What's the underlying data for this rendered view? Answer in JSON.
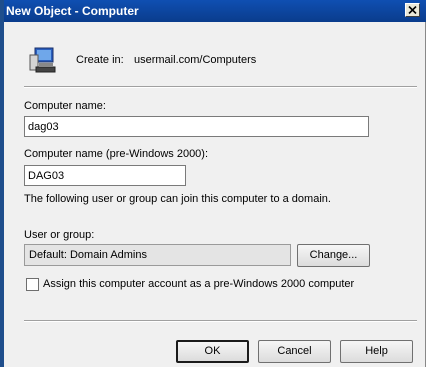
{
  "window": {
    "title": "New Object - Computer",
    "close_icon": "close-icon"
  },
  "header": {
    "icon": "computer-icon",
    "create_in_label": "Create in:",
    "create_in_value": "usermail.com/Computers"
  },
  "form": {
    "computer_name_label": "Computer name:",
    "computer_name_value": "dag03",
    "pre2000_label": "Computer name (pre-Windows 2000):",
    "pre2000_value": "DAG03",
    "info_text": "The following user or group can join this computer to a domain.",
    "user_group_label": "User or group:",
    "user_group_value": "Default: Domain Admins",
    "change_button": "Change...",
    "assign_checkbox_label": "Assign this computer account as a pre-Windows 2000 computer",
    "assign_checked": false
  },
  "buttons": {
    "ok": "OK",
    "cancel": "Cancel",
    "help": "Help"
  }
}
